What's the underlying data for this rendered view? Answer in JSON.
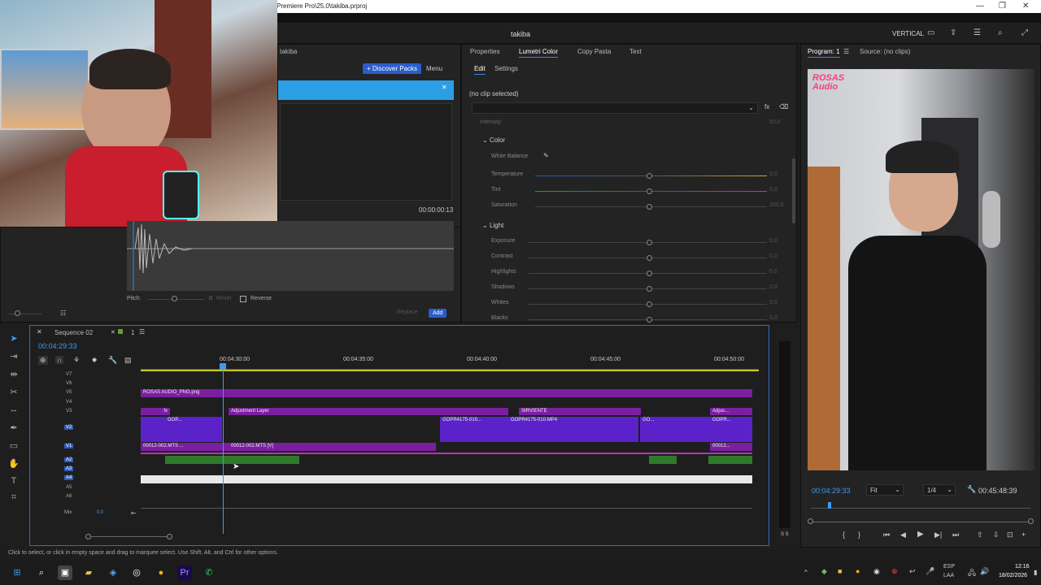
{
  "window": {
    "title": "Premiere Pro\\25.0\\takiba.prproj"
  },
  "appbar": {
    "project": "takiba",
    "workspace": "VERTICAL"
  },
  "essential": {
    "tab": "takiba",
    "discover": "+ Discover Packs",
    "menu": "Menu",
    "timecode": "00:00:00:13",
    "pitch_label": "Pitch:",
    "pitch_value": "0",
    "reset": "Reset",
    "reverse": "Reverse",
    "replace": "Replace",
    "add": "Add"
  },
  "lumetri": {
    "tabs": [
      "Properties",
      "Lumetri Color",
      "Copy Pasta",
      "Text"
    ],
    "subtabs": [
      "Edit",
      "Settings"
    ],
    "clip_status": "(no clip selected)",
    "intensity": "Intensity",
    "intensity_value": "50,0",
    "color_section": "Color",
    "white_balance": "White Balance",
    "color_rows": [
      {
        "label": "Temperature",
        "value": "0,0"
      },
      {
        "label": "Tint",
        "value": "0,0"
      },
      {
        "label": "Saturation",
        "value": "100,0"
      }
    ],
    "light_section": "Light",
    "light_rows": [
      {
        "label": "Exposure",
        "value": "0,0"
      },
      {
        "label": "Contrast",
        "value": "0,0"
      },
      {
        "label": "Highlights",
        "value": "0,0"
      },
      {
        "label": "Shadows",
        "value": "0,0"
      },
      {
        "label": "Whites",
        "value": "0,0"
      },
      {
        "label": "Blacks",
        "value": "0,0"
      }
    ]
  },
  "program": {
    "tab": "Program: 1",
    "source": "Source: (no clips)",
    "timecode": "00:04:29:33",
    "fit": "Fit",
    "quality": "1/4",
    "duration": "00:45:48:39",
    "overlay": "ROSAS Audio"
  },
  "timeline": {
    "sequence": "Sequence 02",
    "count": "1",
    "timecode": "00:04:29:33",
    "ruler": [
      "00:04:30:00",
      "00:04:35:00",
      "00:04:40:00",
      "00:04:45:00",
      "00:04:50:00"
    ],
    "video_tracks": [
      "V7",
      "V6",
      "V5",
      "V4",
      "V3",
      "V2",
      "V1"
    ],
    "audio_tracks": [
      "A2",
      "A3",
      "A4",
      "A5",
      "A6"
    ],
    "mix": "Mix",
    "mix_value": "0,0",
    "clips": {
      "v5": "ROSAS AUDIO_PNG.png",
      "v3a": "Adjustment Layer",
      "v3b": "SIRVIENTE",
      "v3c": "Adjus...",
      "v2a": "GOP...",
      "v2b": "GOPR4175-010...",
      "v2c": "GOPR4175-010.MP4",
      "v2d": "GO...",
      "v2e": "GOPR...",
      "v1a": "00012-002.MTS ...",
      "v1b": "00012-002.MTS [V]",
      "v1c": "00012..."
    },
    "fx": "fx",
    "meter_label": "S S"
  },
  "status": "Click to select, or click in empty space and drag to marquee select. Use Shift, Alt, and Ctrl for other options.",
  "taskbar": {
    "lang": "ESP",
    "region": "LAA",
    "time": "12:16",
    "date": "18/02/2026"
  }
}
